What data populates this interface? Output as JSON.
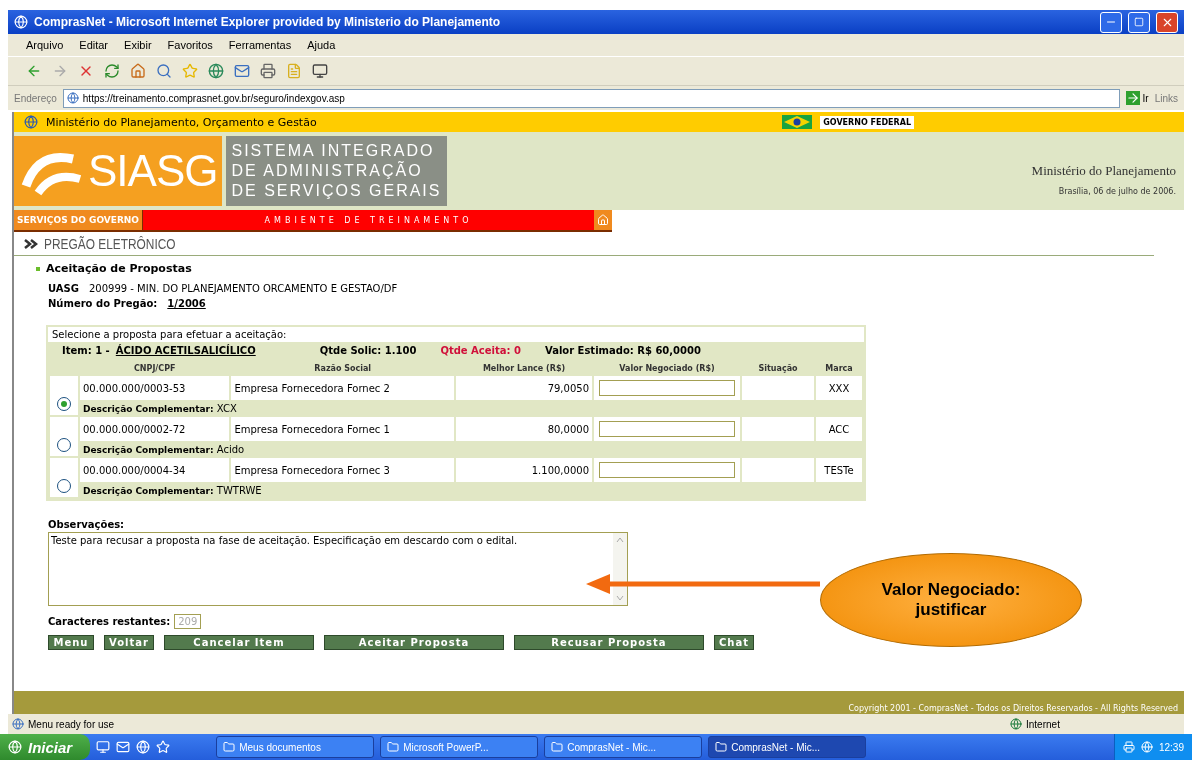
{
  "window": {
    "title": "ComprasNet - Microsoft Internet Explorer provided by Ministerio do Planejamento"
  },
  "menu": [
    "Arquivo",
    "Editar",
    "Exibir",
    "Favoritos",
    "Ferramentas",
    "Ajuda"
  ],
  "address": {
    "label": "Endereço",
    "url": "https://treinamento.comprasnet.gov.br/seguro/indexgov.asp",
    "go": "Ir",
    "links": "Links"
  },
  "site": {
    "ministry": "Ministério do Planejamento, Orçamento e Gestão",
    "gov_badge": "GOVERNO FEDERAL",
    "logo": "SIASG",
    "logo_lines": [
      "SISTEMA INTEGRADO",
      "DE ADMINISTRAÇÃO",
      "DE SERVIÇOS GERAIS"
    ],
    "org": "Ministério do Planejamento",
    "date": "Brasília, 06 de julho de 2006.",
    "services": "SERVIÇOS DO GOVERNO",
    "environment": "AMBIENTE DE TREINAMENTO",
    "section": "PREGÃO ELETRÔNICO"
  },
  "form": {
    "title": "Aceitação de Propostas",
    "uasg_label": "UASG",
    "uasg_value": "200999 - MIN. DO PLANEJAMENTO ORCAMENTO E GESTAO/DF",
    "pregao_label": "Número do Pregão:",
    "pregao_value": "1/2006",
    "instruction": "Selecione a proposta para efetuar a aceitação:",
    "item_label": "Item: 1 -",
    "item_name": "ÁCIDO ACETILSALICÍLICO",
    "qtde_solic": "Qtde Solic: 1.100",
    "qtde_aceita": "Qtde Aceita: 0",
    "valor_estimado": "Valor Estimado: R$ 60,0000",
    "columns": [
      "CNPJ/CPF",
      "Razão Social",
      "Melhor Lance (R$)",
      "Valor Negociado (R$)",
      "Situação",
      "Marca"
    ],
    "rows": [
      {
        "selected": true,
        "cnpj": "00.000.000/0003-53",
        "razao": "Empresa Fornecedora Fornec 2",
        "lance": "79,0050",
        "marca": "XXX",
        "desc_label": "Descrição Complementar:",
        "desc": "XCX"
      },
      {
        "selected": false,
        "cnpj": "00.000.000/0002-72",
        "razao": "Empresa Fornecedora Fornec 1",
        "lance": "80,0000",
        "marca": "ACC",
        "desc_label": "Descrição Complementar:",
        "desc": "Acido"
      },
      {
        "selected": false,
        "cnpj": "00.000.000/0004-34",
        "razao": "Empresa Fornecedora Fornec 3",
        "lance": "1.100,0000",
        "marca": "TESTe",
        "desc_label": "Descrição Complementar:",
        "desc": "TWTRWE"
      }
    ],
    "obs_label": "Observações:",
    "obs_text": "Teste para recusar a proposta na fase de aceitação. Especificação em descardo com o edital.",
    "chars_label": "Caracteres restantes:",
    "chars_value": "209",
    "buttons": [
      "Menu",
      "Voltar",
      "Cancelar Item",
      "Aceitar Proposta",
      "Recusar Proposta",
      "Chat"
    ]
  },
  "copyright": "Copyright 2001 - ComprasNet - Todos os Direitos Reservados - All Rights Reserved",
  "callout": [
    "Valor Negociado:",
    "justificar"
  ],
  "status": {
    "text": "Menu ready for use",
    "zone": "Internet"
  },
  "taskbar": {
    "start": "Iniciar",
    "tasks": [
      {
        "label": "Meus documentos",
        "selected": false
      },
      {
        "label": "Microsoft PowerP...",
        "selected": false
      },
      {
        "label": "ComprasNet - Mic...",
        "selected": false
      },
      {
        "label": "ComprasNet - Mic...",
        "selected": true
      }
    ],
    "clock": "12:39"
  }
}
